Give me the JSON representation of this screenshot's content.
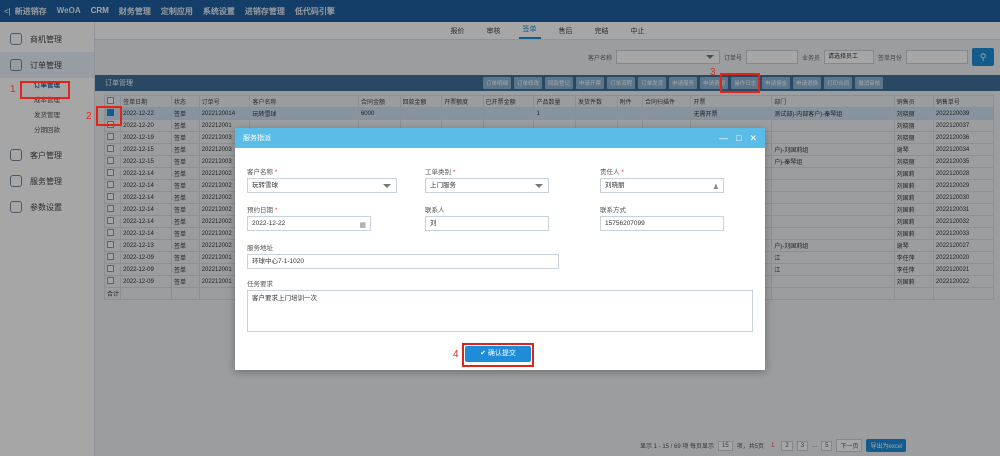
{
  "topnav": {
    "back": "<|",
    "items": [
      "新进销存",
      "WeOA",
      "CRM",
      "财务管理",
      "定制应用",
      "系统设置",
      "进销存管理",
      "低代码引擎"
    ]
  },
  "sidebar": {
    "items": [
      {
        "label": "商机管理"
      },
      {
        "label": "订单管理"
      },
      {
        "label": "客户管理"
      },
      {
        "label": "服务管理"
      },
      {
        "label": "参数设置"
      }
    ],
    "subitems": [
      "订单管理",
      "成本管理",
      "发货管理",
      "分期回款"
    ]
  },
  "tabs": [
    "报价",
    "审核",
    "签单",
    "售后",
    "完结",
    "中止"
  ],
  "filters": {
    "customer_label": "客户名称",
    "order_label": "订单号",
    "salesperson_label": "业务员",
    "salesperson_value": "请选择员工",
    "month_label": "签单月份",
    "search_icon": "search-icon"
  },
  "grid_title": "订单管理",
  "actions": [
    "订单明细",
    "订单修改",
    "回款登记",
    "申请开票",
    "订单流程",
    "订单发货",
    "申请服务",
    "申请费用",
    "操作日志",
    "申请佣金",
    "申请退换",
    "打印合同",
    "撤消审核"
  ],
  "columns": [
    "签单日期",
    "状态",
    "订单号",
    "客户名称",
    "合同金额",
    "回款金额",
    "开票额度",
    "已开票金额",
    "产品数量",
    "发货件数",
    "附件",
    "合同扫描件",
    "开票",
    "部门",
    "销售员",
    "销售单号"
  ],
  "rows": [
    {
      "date": "2022-12-22",
      "status": "签单",
      "order": "2022120014",
      "customer": "玩转雪球",
      "amount": "6000",
      "qty": "1",
      "invoice": "无需开票",
      "dept": "测试部)-内部客户)-秦琴组",
      "sales": "刘晓丽",
      "no": "2022120039"
    },
    {
      "date": "2022-12-20",
      "status": "签单",
      "order": "202212001",
      "customer": "",
      "amount": "",
      "qty": "",
      "invoice": "",
      "dept": "",
      "sales": "刘晓丽",
      "no": "2022120037"
    },
    {
      "date": "2022-12-19",
      "status": "签单",
      "order": "202212003",
      "customer": "",
      "amount": "",
      "qty": "",
      "invoice": "",
      "dept": "",
      "sales": "刘晓丽",
      "no": "2022120036"
    },
    {
      "date": "2022-12-15",
      "status": "签单",
      "order": "202212003",
      "customer": "",
      "amount": "",
      "qty": "",
      "invoice": "",
      "dept": "户)-刘国莉组",
      "sales": "谢琴",
      "no": "2022120034"
    },
    {
      "date": "2022-12-15",
      "status": "签单",
      "order": "202212003",
      "customer": "",
      "amount": "",
      "qty": "",
      "invoice": "",
      "dept": "户)-秦琴组",
      "sales": "刘晓丽",
      "no": "2022120035"
    },
    {
      "date": "2022-12-14",
      "status": "签单",
      "order": "202212002",
      "customer": "",
      "amount": "",
      "qty": "",
      "invoice": "",
      "dept": "",
      "sales": "刘国莉",
      "no": "2022120028"
    },
    {
      "date": "2022-12-14",
      "status": "签单",
      "order": "202212002",
      "customer": "",
      "amount": "",
      "qty": "",
      "invoice": "",
      "dept": "",
      "sales": "刘国莉",
      "no": "2022120029"
    },
    {
      "date": "2022-12-14",
      "status": "签单",
      "order": "202212002",
      "customer": "",
      "amount": "",
      "qty": "",
      "invoice": "",
      "dept": "",
      "sales": "刘国莉",
      "no": "2022120030"
    },
    {
      "date": "2022-12-14",
      "status": "签单",
      "order": "202212002",
      "customer": "",
      "amount": "",
      "qty": "",
      "invoice": "",
      "dept": "",
      "sales": "刘国莉",
      "no": "2022120031"
    },
    {
      "date": "2022-12-14",
      "status": "签单",
      "order": "202212002",
      "customer": "",
      "amount": "",
      "qty": "",
      "invoice": "",
      "dept": "",
      "sales": "刘国莉",
      "no": "2022120032"
    },
    {
      "date": "2022-12-14",
      "status": "签单",
      "order": "202212002",
      "customer": "",
      "amount": "",
      "qty": "",
      "invoice": "",
      "dept": "",
      "sales": "刘国莉",
      "no": "2022120033"
    },
    {
      "date": "2022-12-13",
      "status": "签单",
      "order": "202212002",
      "customer": "",
      "amount": "",
      "qty": "",
      "invoice": "",
      "dept": "户)-刘国莉组",
      "sales": "谢琴",
      "no": "2022120027"
    },
    {
      "date": "2022-12-09",
      "status": "签单",
      "order": "202212001",
      "customer": "",
      "amount": "",
      "qty": "",
      "invoice": "",
      "dept": "江",
      "sales": "李任萍",
      "no": "2022120020"
    },
    {
      "date": "2022-12-09",
      "status": "签单",
      "order": "202212001",
      "customer": "",
      "amount": "",
      "qty": "",
      "invoice": "",
      "dept": "江",
      "sales": "李任萍",
      "no": "2022120021"
    },
    {
      "date": "2022-12-09",
      "status": "签单",
      "order": "202212001",
      "customer": "",
      "amount": "",
      "qty": "",
      "invoice": "",
      "dept": "",
      "sales": "刘国莉",
      "no": "2022120022"
    }
  ],
  "total_label": "合计",
  "footer": {
    "summary": "显示 1 - 15 / 69 项 每页显示",
    "page_size": "15",
    "suffix": "项，共5页",
    "pages": [
      "1",
      "2",
      "3",
      "...",
      "5"
    ],
    "next": "下一页",
    "export": "导出为excel"
  },
  "dialog": {
    "title": "服务指派",
    "customer_label": "客户名称",
    "customer_value": "玩转雪球",
    "type_label": "工单类别",
    "type_value": "上门服务",
    "owner_label": "责任人",
    "owner_value": "刘晓丽",
    "date_label": "预约日期",
    "date_value": "2022-12-22",
    "contact_label": "联系人",
    "contact_value": "刘",
    "phone_label": "联系方式",
    "phone_value": "15756207099",
    "address_label": "服务地址",
    "address_value": "环球中心7-1-1020",
    "request_label": "任务要求",
    "request_value": "客户要求上门培训一次",
    "submit": "确认提交"
  },
  "annotations": [
    "1",
    "2",
    "3",
    "4"
  ],
  "colors": {
    "topbar": "#1f5f9e",
    "accent": "#1f8cd9",
    "dialog_header": "#5bbde7",
    "highlight": "#e2231a"
  }
}
